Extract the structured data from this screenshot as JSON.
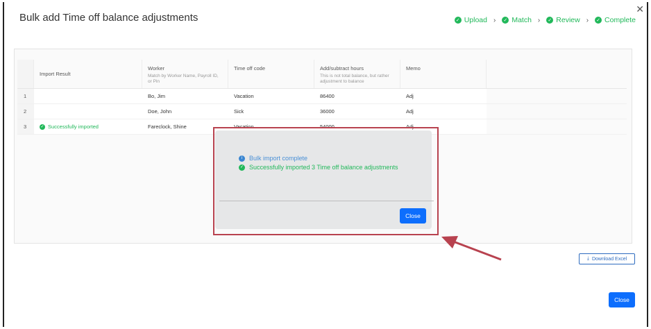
{
  "dialog": {
    "title": "Bulk add Time off balance adjustments",
    "steps": [
      "Upload",
      "Match",
      "Review",
      "Complete"
    ]
  },
  "grid": {
    "columns": [
      {
        "label": "Import Result",
        "sub": ""
      },
      {
        "label": "Worker",
        "sub": "Match by Worker Name, Payroll ID, or Pin"
      },
      {
        "label": "Time off code",
        "sub": ""
      },
      {
        "label": "Add/subtract hours",
        "sub": "This is not total balance, but rather adjustment to balance"
      },
      {
        "label": "Memo",
        "sub": ""
      }
    ],
    "rows": [
      {
        "n": "1",
        "result": "",
        "worker": "Bo, Jim",
        "code": "Vacation",
        "hours": "86400",
        "memo": "Adj"
      },
      {
        "n": "2",
        "result": "",
        "worker": "Doe, John",
        "code": "Sick",
        "hours": "36000",
        "memo": "Adj"
      },
      {
        "n": "3",
        "result": "Successfully imported",
        "worker": "Fareclock, Shine",
        "code": "Vacation",
        "hours": "54000",
        "memo": "Adj"
      }
    ]
  },
  "popup": {
    "info": "Bulk import complete",
    "success": "Successfully imported 3 Time off balance adjustments",
    "close_label": "Close"
  },
  "footer": {
    "download_label": "Download Excel",
    "close_label": "Close"
  },
  "colors": {
    "accent": "#0d6efd",
    "success": "#21b85a",
    "highlight": "#b8424f"
  }
}
